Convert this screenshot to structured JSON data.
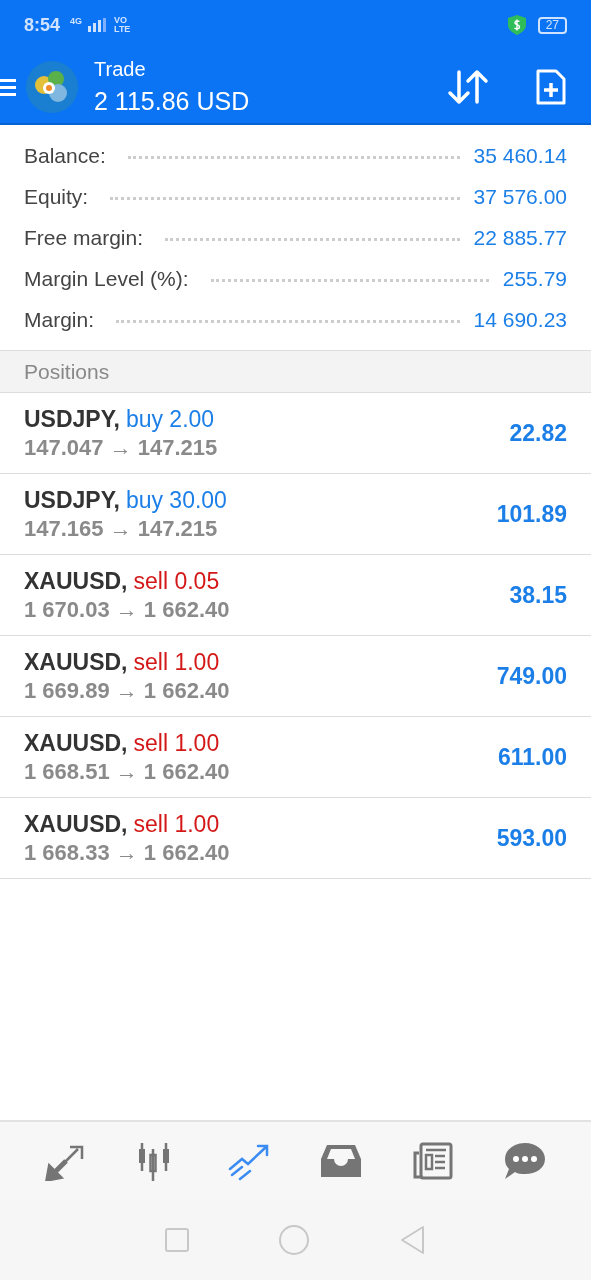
{
  "status_bar": {
    "time": "8:54",
    "network": "4G",
    "volte": [
      "VO",
      "LTE"
    ],
    "battery": "27"
  },
  "header": {
    "title": "Trade",
    "balance": "2 115.86 USD"
  },
  "summary": [
    {
      "label": "Balance:",
      "value": "35 460.14"
    },
    {
      "label": "Equity:",
      "value": "37 576.00"
    },
    {
      "label": "Free margin:",
      "value": "22 885.77"
    },
    {
      "label": "Margin Level (%):",
      "value": "255.79"
    },
    {
      "label": "Margin:",
      "value": "14 690.23"
    }
  ],
  "positions_header": "Positions",
  "positions": [
    {
      "symbol": "USDJPY,",
      "kind": "buy",
      "order": "buy 2.00",
      "prices": "147.047 → 147.215",
      "profit": "22.82"
    },
    {
      "symbol": "USDJPY,",
      "kind": "buy",
      "order": "buy 30.00",
      "prices": "147.165 → 147.215",
      "profit": "101.89"
    },
    {
      "symbol": "XAUUSD,",
      "kind": "sell",
      "order": "sell 0.05",
      "prices": "1 670.03 → 1 662.40",
      "profit": "38.15"
    },
    {
      "symbol": "XAUUSD,",
      "kind": "sell",
      "order": "sell 1.00",
      "prices": "1 669.89 → 1 662.40",
      "profit": "749.00"
    },
    {
      "symbol": "XAUUSD,",
      "kind": "sell",
      "order": "sell 1.00",
      "prices": "1 668.51 → 1 662.40",
      "profit": "611.00"
    },
    {
      "symbol": "XAUUSD,",
      "kind": "sell",
      "order": "sell 1.00",
      "prices": "1 668.33 → 1 662.40",
      "profit": "593.00"
    }
  ],
  "bottom_nav": [
    {
      "kind": "quotes",
      "selected": false
    },
    {
      "kind": "chart",
      "selected": false
    },
    {
      "kind": "trade",
      "selected": true
    },
    {
      "kind": "history",
      "selected": false
    },
    {
      "kind": "news",
      "selected": false
    },
    {
      "kind": "chat",
      "selected": false
    }
  ]
}
